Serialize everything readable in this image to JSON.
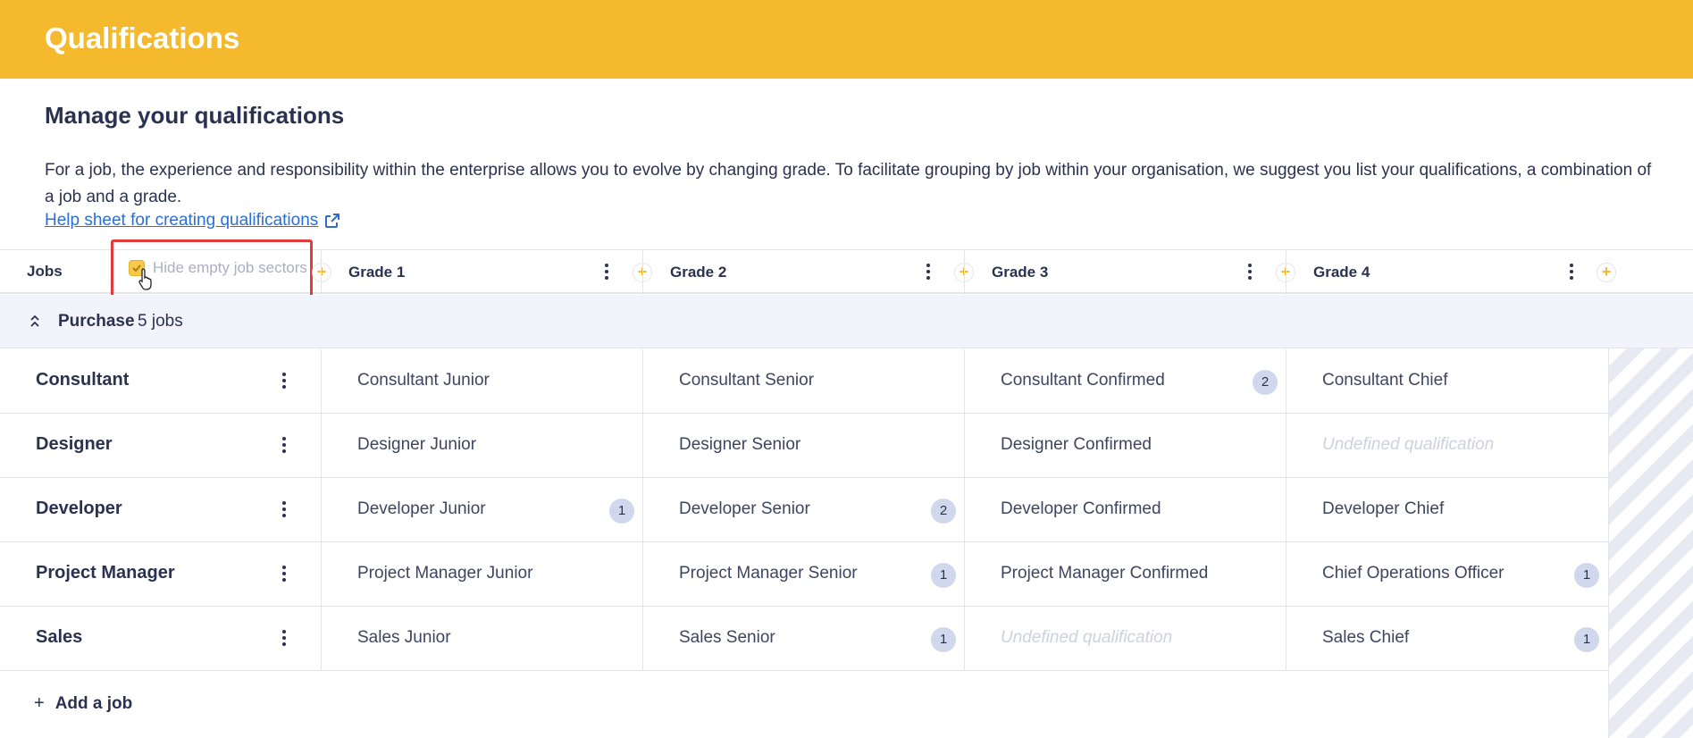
{
  "header": {
    "title": "Qualifications"
  },
  "intro": {
    "title": "Manage your qualifications",
    "description": "For a job, the experience and responsibility within the enterprise allows you to evolve by changing grade. To facilitate grouping by job within your organisation, we suggest you list your qualifications, a combination of a job and a grade.",
    "help_link": "Help sheet for creating qualifications"
  },
  "grid": {
    "jobs_label": "Jobs",
    "hide_empty_label": "Hide empty job sectors",
    "add_symbol": "+",
    "grades": [
      "Grade 1",
      "Grade 2",
      "Grade 3",
      "Grade 4"
    ],
    "sector": {
      "name": "Purchase",
      "count": "5 jobs"
    },
    "rows": [
      {
        "job": "Consultant",
        "cells": [
          {
            "text": "Consultant  Junior",
            "badge": ""
          },
          {
            "text": "Consultant  Senior",
            "badge": ""
          },
          {
            "text": "Consultant  Confirmed",
            "badge": "2"
          },
          {
            "text": "Consultant  Chief",
            "badge": ""
          }
        ]
      },
      {
        "job": "Designer",
        "cells": [
          {
            "text": "Designer Junior",
            "badge": ""
          },
          {
            "text": "Designer Senior",
            "badge": ""
          },
          {
            "text": "Designer Confirmed",
            "badge": ""
          },
          {
            "text": "Undefined qualification",
            "badge": "",
            "undefined": true
          }
        ]
      },
      {
        "job": "Developer",
        "cells": [
          {
            "text": "Developer Junior",
            "badge": "1"
          },
          {
            "text": "Developer Senior",
            "badge": "2"
          },
          {
            "text": "Developer Confirmed",
            "badge": ""
          },
          {
            "text": "Developer Chief",
            "badge": ""
          }
        ]
      },
      {
        "job": "Project Manager",
        "cells": [
          {
            "text": "Project Manager Junior",
            "badge": ""
          },
          {
            "text": "Project Manager Senior",
            "badge": "1"
          },
          {
            "text": "Project Manager Confirmed",
            "badge": ""
          },
          {
            "text": "Chief Operations Officer",
            "badge": "1"
          }
        ]
      },
      {
        "job": "Sales",
        "cells": [
          {
            "text": "Sales Junior",
            "badge": ""
          },
          {
            "text": "Sales Senior",
            "badge": "1"
          },
          {
            "text": "Undefined qualification",
            "badge": "",
            "undefined": true
          },
          {
            "text": "Sales Chief",
            "badge": "1"
          }
        ]
      }
    ],
    "add_job": "Add a job"
  },
  "colors": {
    "accent": "#f4b92d",
    "link": "#2b6fd6",
    "badge": "#cfd8ec",
    "sector_bg": "#f2f3fb"
  }
}
